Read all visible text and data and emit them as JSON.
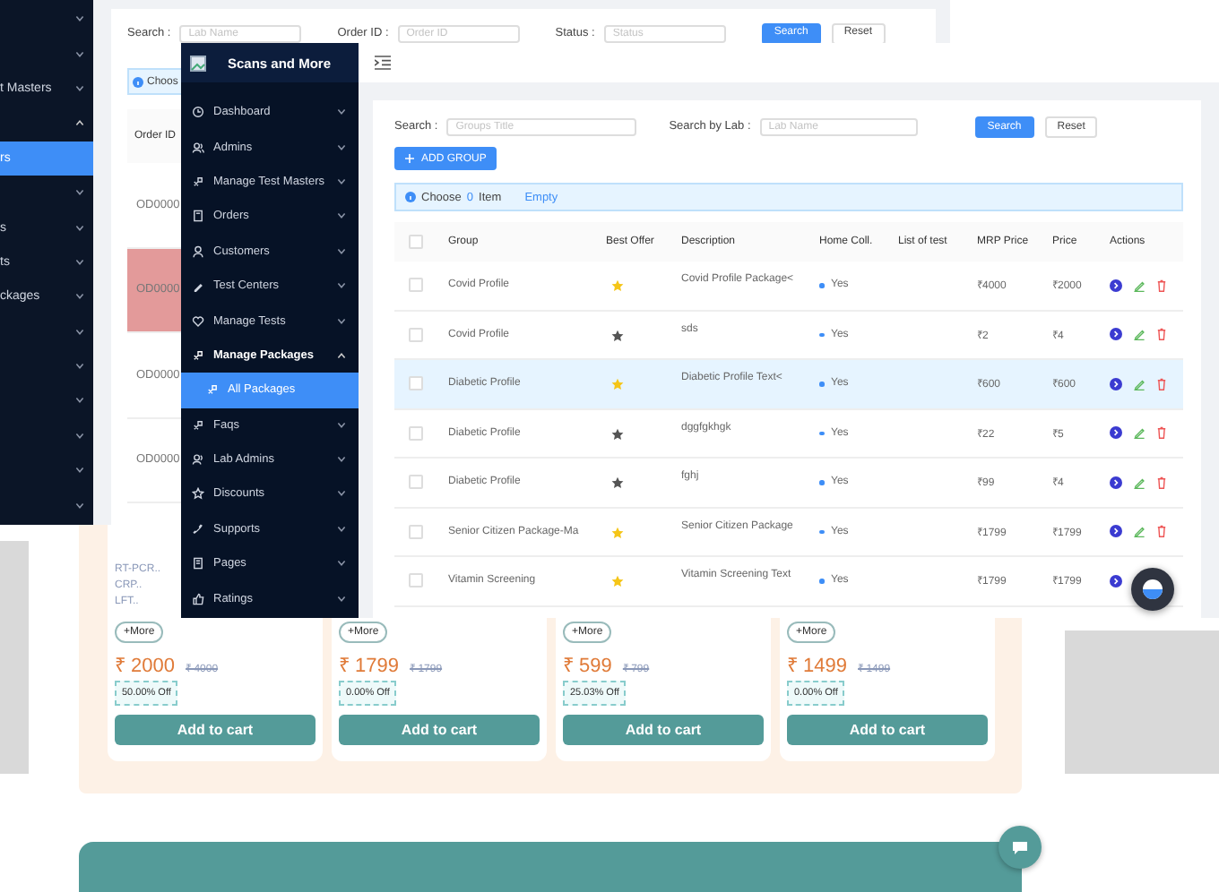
{
  "back_window": {
    "sidebar_items": [
      {
        "expanded": false,
        "selected": false
      },
      {
        "expanded": false,
        "selected": false
      },
      {
        "label": "t Masters",
        "expanded": false,
        "selected": false
      },
      {
        "expanded": true,
        "selected": false
      },
      {
        "label": "rs",
        "selected": true
      },
      {
        "expanded": false,
        "selected": false
      },
      {
        "label": "s",
        "expanded": false,
        "selected": false
      },
      {
        "label": "ts",
        "expanded": false,
        "selected": false
      },
      {
        "label": "ckages",
        "expanded": false,
        "selected": false
      },
      {
        "expanded": false,
        "selected": false
      },
      {
        "expanded": false,
        "selected": false
      },
      {
        "expanded": false,
        "selected": false
      },
      {
        "expanded": false,
        "selected": false
      },
      {
        "expanded": false,
        "selected": false
      },
      {
        "expanded": false,
        "selected": false
      }
    ],
    "filters": [
      {
        "label": "Search :",
        "placeholder": "Lab Name"
      },
      {
        "label": "Order ID :",
        "placeholder": "Order ID"
      },
      {
        "label": "Status :",
        "placeholder": "Status"
      }
    ],
    "buttons": [
      {
        "label": "Search",
        "primary": true
      },
      {
        "label": "Reset",
        "primary": false
      }
    ],
    "info": "Choos",
    "table": {
      "columns": [
        "Order ID"
      ],
      "rows": [
        {
          "order_id": "OD0000",
          "flagged": false
        },
        {
          "order_id": "OD0000",
          "flagged": true
        },
        {
          "order_id": "OD0000",
          "flagged": false
        },
        {
          "order_id": "OD0000",
          "flagged": false
        }
      ]
    }
  },
  "packages": [
    {
      "tests": [
        "RT-PCR..",
        "CRP..",
        "LFT.."
      ],
      "more": "+More",
      "price": "₹ 2000",
      "mrp": "₹ 4000",
      "discount": "50.00% Off",
      "button": "Add to cart"
    },
    {
      "more": "+More",
      "price": "₹ 1799",
      "mrp": "₹ 1799",
      "discount": "0.00% Off",
      "button": "Add to cart"
    },
    {
      "more": "+More",
      "price": "₹ 599",
      "mrp": "₹ 799",
      "discount": "25.03% Off",
      "button": "Add to cart"
    },
    {
      "more": "+More",
      "price": "₹ 1499",
      "mrp": "₹ 1499",
      "discount": "0.00% Off",
      "button": "Add to cart"
    }
  ],
  "front_window": {
    "brand": "Scans and More",
    "menu": [
      {
        "label": "Dashboard",
        "expanded": false
      },
      {
        "label": "Admins",
        "expanded": false
      },
      {
        "label": "Manage Test Masters",
        "expanded": false
      },
      {
        "label": "Orders",
        "expanded": false
      },
      {
        "label": "Customers",
        "expanded": false
      },
      {
        "label": "Test Centers",
        "expanded": false
      },
      {
        "label": "Manage Tests",
        "expanded": false
      },
      {
        "label": "Manage Packages",
        "expanded": true,
        "children": [
          {
            "label": "All Packages",
            "selected": true
          }
        ]
      },
      {
        "label": "Faqs",
        "expanded": false
      },
      {
        "label": "Lab Admins",
        "expanded": false
      },
      {
        "label": "Discounts",
        "expanded": false
      },
      {
        "label": "Supports",
        "expanded": false
      },
      {
        "label": "Pages",
        "expanded": false
      },
      {
        "label": "Ratings",
        "expanded": false
      }
    ],
    "filters": [
      {
        "label": "Search :",
        "placeholder": "Groups Title"
      },
      {
        "label": "Search by Lab :",
        "placeholder": "Lab Name"
      }
    ],
    "buttons": [
      {
        "label": "Search",
        "primary": true
      },
      {
        "label": "Reset",
        "primary": false
      }
    ],
    "add_button": "ADD GROUP",
    "info": {
      "prefix": "Choose",
      "count": "0",
      "suffix": "Item",
      "link": "Empty"
    },
    "table": {
      "all_checked": false,
      "columns": [
        "Group",
        "Best Offer",
        "Description",
        "Home Coll.",
        "List of test",
        "MRP Price",
        "Price",
        "Actions"
      ],
      "rows": [
        {
          "group": "Covid Profile",
          "best_offer": true,
          "description": "Covid Profile Package<",
          "home_collection": "Yes",
          "mrp": "₹4000",
          "price": "₹2000",
          "checked": false,
          "selected": false,
          "actions": [
            {
              "kind": "view"
            },
            {
              "kind": "edit"
            },
            {
              "kind": "delete"
            }
          ]
        },
        {
          "group": "Covid Profile",
          "best_offer": false,
          "description": "sds",
          "home_collection": "Yes",
          "mrp": "₹2",
          "price": "₹4",
          "checked": false,
          "selected": false,
          "actions": [
            {
              "kind": "view"
            },
            {
              "kind": "edit"
            },
            {
              "kind": "delete"
            }
          ]
        },
        {
          "group": "Diabetic Profile",
          "best_offer": true,
          "description": "Diabetic Profile Text<",
          "home_collection": "Yes",
          "mrp": "₹600",
          "price": "₹600",
          "checked": false,
          "selected": true,
          "actions": [
            {
              "kind": "view"
            },
            {
              "kind": "edit"
            },
            {
              "kind": "delete"
            }
          ]
        },
        {
          "group": "Diabetic Profile",
          "best_offer": false,
          "description": "dggfgkhgk",
          "home_collection": "Yes",
          "mrp": "₹22",
          "price": "₹5",
          "checked": false,
          "selected": false,
          "actions": [
            {
              "kind": "view"
            },
            {
              "kind": "edit"
            },
            {
              "kind": "delete"
            }
          ]
        },
        {
          "group": "Diabetic Profile",
          "best_offer": false,
          "description": "fghj",
          "home_collection": "Yes",
          "mrp": "₹99",
          "price": "₹4",
          "checked": false,
          "selected": false,
          "actions": [
            {
              "kind": "view"
            },
            {
              "kind": "edit"
            },
            {
              "kind": "delete"
            }
          ]
        },
        {
          "group": "Senior Citizen Package-Ma",
          "best_offer": true,
          "description": "Senior Citizen Package",
          "home_collection": "Yes",
          "mrp": "₹1799",
          "price": "₹1799",
          "checked": false,
          "selected": false,
          "actions": [
            {
              "kind": "view"
            },
            {
              "kind": "edit"
            },
            {
              "kind": "delete"
            }
          ]
        },
        {
          "group": "Vitamin Screening",
          "best_offer": true,
          "description": "Vitamin Screening Text",
          "home_collection": "Yes",
          "mrp": "₹1799",
          "price": "₹1799",
          "checked": false,
          "selected": false,
          "actions": [
            {
              "kind": "view"
            }
          ]
        }
      ]
    }
  }
}
